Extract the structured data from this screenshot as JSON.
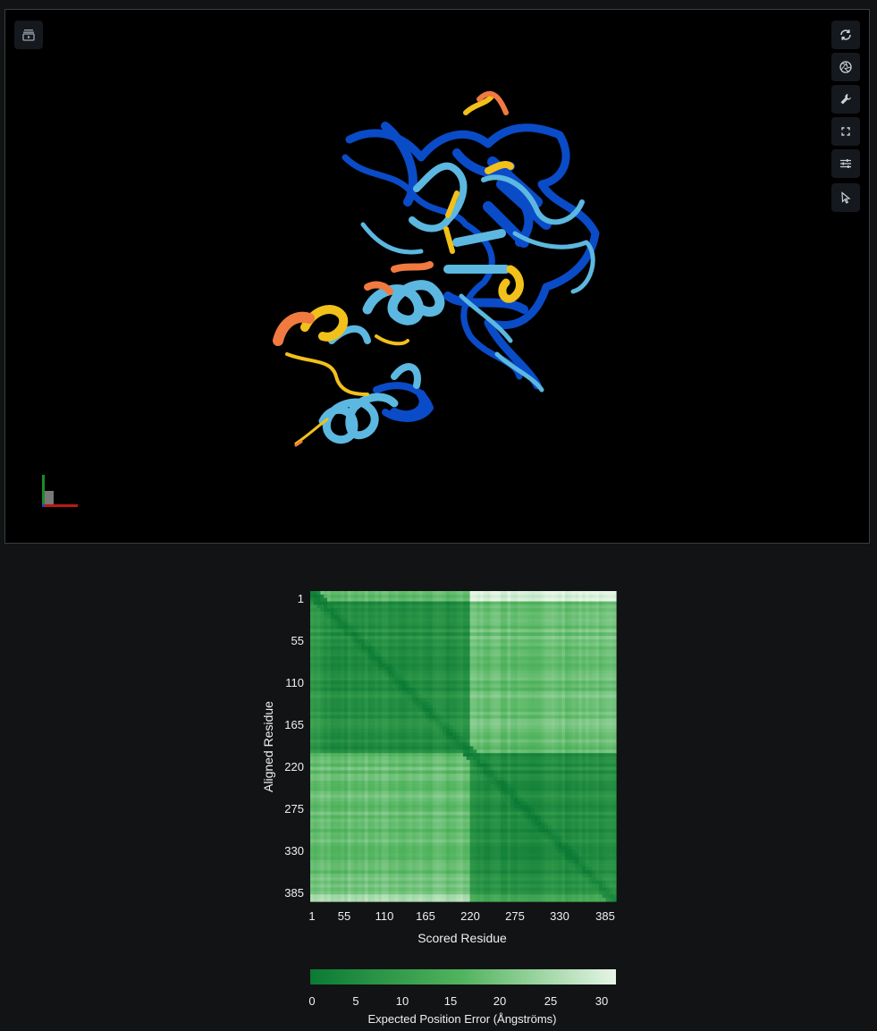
{
  "viewer": {
    "toolbar": [
      {
        "name": "reset-view-icon"
      },
      {
        "name": "screenshot-camera-icon"
      },
      {
        "name": "wrench-settings-icon"
      },
      {
        "name": "fullscreen-icon"
      },
      {
        "name": "sliders-controls-icon"
      },
      {
        "name": "selection-cursor-icon"
      }
    ],
    "animation_toggle_icon": "animation-toggle-icon",
    "confidence_colors": {
      "very_high": "#0053d6",
      "confident": "#65cbf3",
      "low": "#ffdb13",
      "very_low": "#ff7d45"
    }
  },
  "pae_plot": {
    "xlabel": "Scored Residue",
    "ylabel": "Aligned Residue",
    "ticks": [
      "1",
      "55",
      "110",
      "165",
      "220",
      "275",
      "330",
      "385"
    ],
    "colorbar": {
      "label": "Expected Position Error (Ångströms)",
      "ticks": [
        "0",
        "5",
        "10",
        "15",
        "20",
        "25",
        "30"
      ],
      "min_color": "#0b7a34",
      "max_color": "#e6f5e6"
    }
  },
  "chart_data": {
    "type": "heatmap",
    "xlabel": "Scored Residue",
    "ylabel": "Aligned Residue",
    "xlim": [
      1,
      385
    ],
    "ylim": [
      1,
      385
    ],
    "x_ticks": [
      1,
      55,
      110,
      165,
      220,
      275,
      330,
      385
    ],
    "y_ticks": [
      1,
      55,
      110,
      165,
      220,
      275,
      330,
      385
    ],
    "colorbar_range": [
      0,
      30
    ],
    "colorbar_label": "Expected Position Error (Ångströms)",
    "domains": [
      {
        "start": 1,
        "end": 200
      },
      {
        "start": 200,
        "end": 385
      }
    ],
    "approx_pae": {
      "diagonal": 1,
      "within_domain": 5,
      "between_domains": 17,
      "disordered_nterm_rows": 12
    }
  }
}
